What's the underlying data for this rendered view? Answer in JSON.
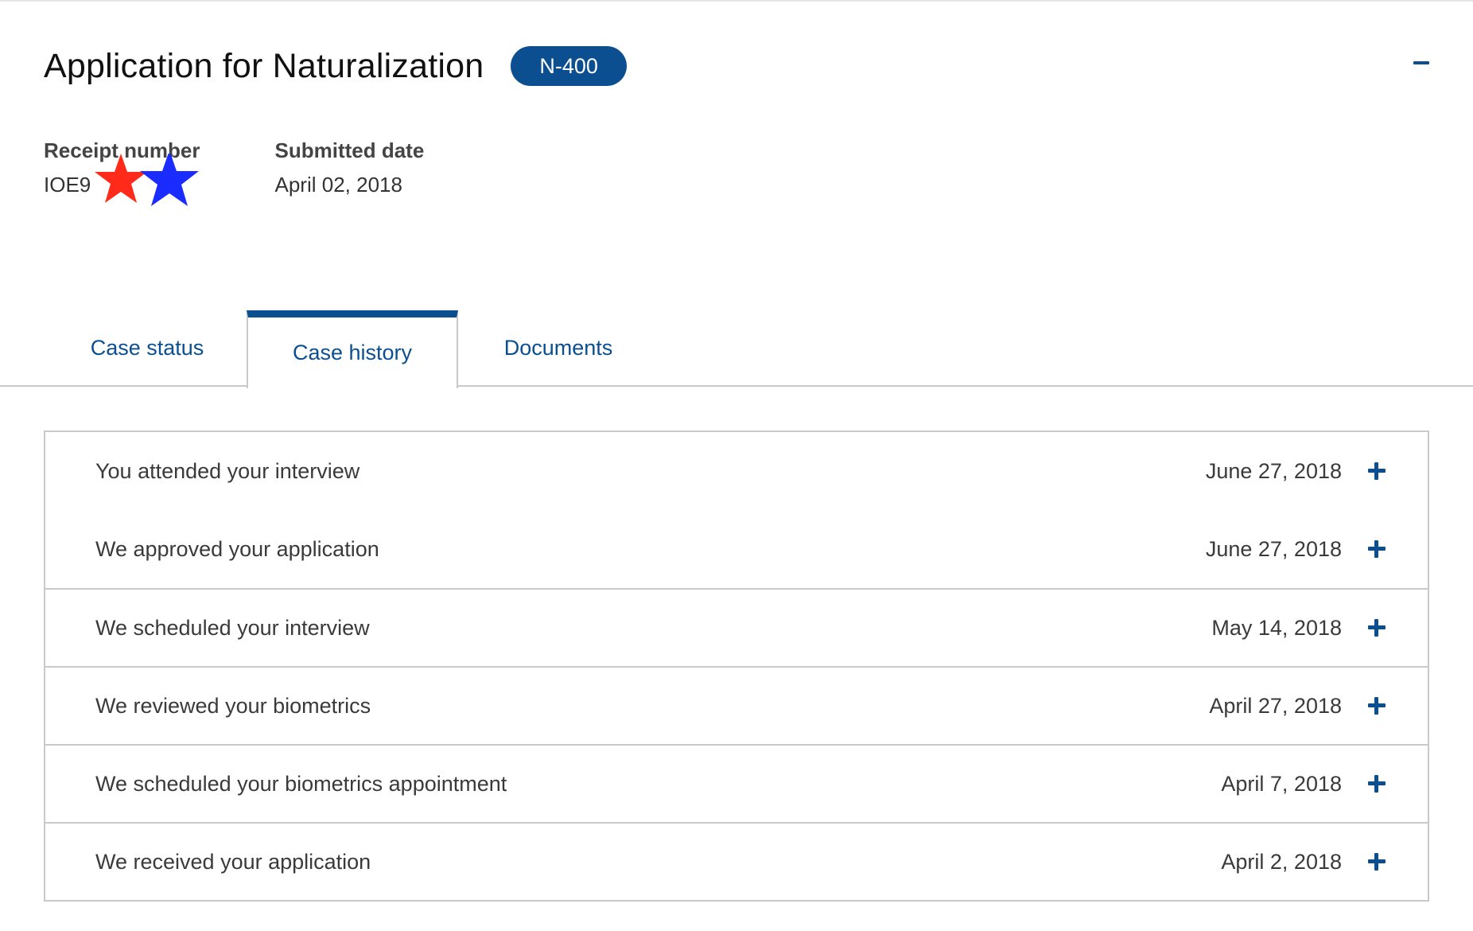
{
  "header": {
    "title": "Application for Naturalization",
    "form_badge": "N-400",
    "collapse_icon": "minus-icon"
  },
  "meta": {
    "receipt_label": "Receipt number",
    "receipt_value": "IOE9",
    "submitted_label": "Submitted date",
    "submitted_value": "April 02, 2018"
  },
  "tabs": [
    {
      "label": "Case status",
      "active": false
    },
    {
      "label": "Case history",
      "active": true
    },
    {
      "label": "Documents",
      "active": false
    }
  ],
  "history": [
    {
      "event": "You attended your interview",
      "date": "June 27, 2018"
    },
    {
      "event": "We approved your application",
      "date": "June 27, 2018"
    },
    {
      "event": "We scheduled your interview",
      "date": "May 14, 2018"
    },
    {
      "event": "We reviewed your biometrics",
      "date": "April 27, 2018"
    },
    {
      "event": "We scheduled your biometrics appointment",
      "date": "April 7, 2018"
    },
    {
      "event": "We received your application",
      "date": "April 2, 2018"
    }
  ],
  "colors": {
    "accent": "#0b4f91",
    "border": "#c9c9c9",
    "star_red": "#ff2a1a",
    "star_blue": "#1a2cff"
  },
  "icons": {
    "expand": "plus-icon",
    "redaction": "star-icon"
  }
}
